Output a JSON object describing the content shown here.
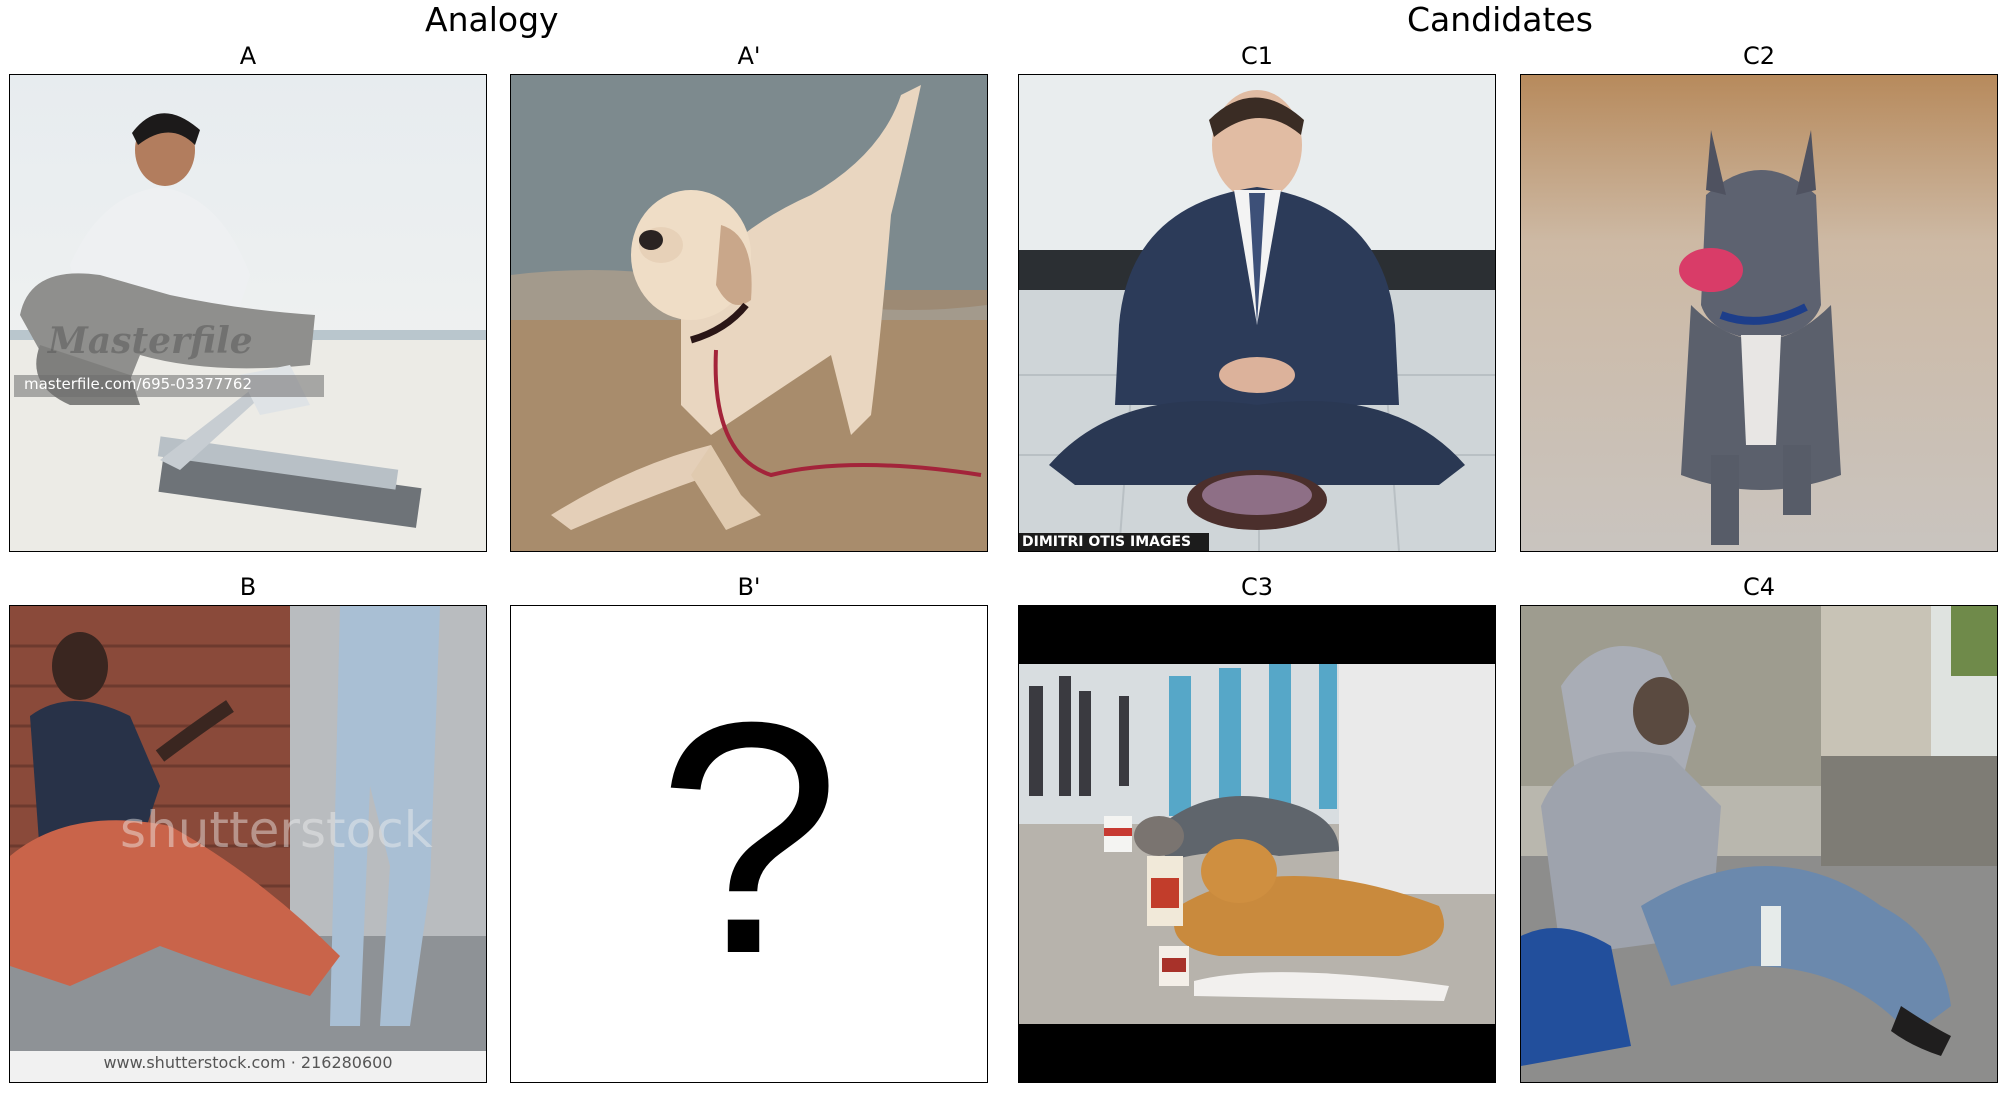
{
  "titles": {
    "analogy": "Analogy",
    "candidates": "Candidates"
  },
  "panels": {
    "A": {
      "label": "A",
      "watermark": "Masterfile",
      "watermark_sub": "masterfile.com/695-03377762"
    },
    "A2": {
      "label": "A'"
    },
    "B": {
      "label": "B",
      "watermark": "shutterstock",
      "footer": "www.shutterstock.com · 216280600"
    },
    "B2": {
      "label": "B'",
      "glyph": "?"
    },
    "C1": {
      "label": "C1",
      "credit": "DIMITRI OTIS IMAGES"
    },
    "C2": {
      "label": "C2"
    },
    "C3": {
      "label": "C3"
    },
    "C4": {
      "label": "C4"
    }
  }
}
